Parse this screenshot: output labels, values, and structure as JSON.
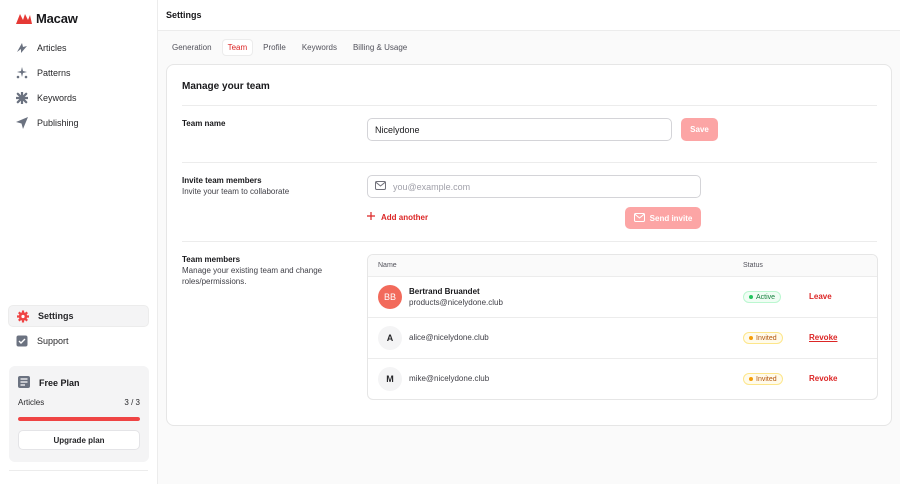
{
  "app": {
    "name": "Macaw"
  },
  "sidebar": {
    "items": [
      {
        "label": "Articles",
        "icon": "articles-icon"
      },
      {
        "label": "Patterns",
        "icon": "patterns-icon"
      },
      {
        "label": "Keywords",
        "icon": "keywords-icon"
      },
      {
        "label": "Publishing",
        "icon": "publishing-icon"
      }
    ],
    "bottom_items": [
      {
        "label": "Settings",
        "icon": "gear-icon",
        "active": true
      },
      {
        "label": "Support",
        "icon": "support-icon"
      }
    ],
    "plan": {
      "title": "Free Plan",
      "usage_label": "Articles",
      "usage_value": "3 / 3",
      "usage_fraction": 1.0,
      "upgrade_label": "Upgrade plan"
    }
  },
  "header": {
    "title": "Settings"
  },
  "tabs": [
    {
      "label": "Generation",
      "active": false
    },
    {
      "label": "Team",
      "active": true
    },
    {
      "label": "Profile",
      "active": false
    },
    {
      "label": "Keywords",
      "active": false
    },
    {
      "label": "Billing & Usage",
      "active": false
    }
  ],
  "card": {
    "title": "Manage your team",
    "team_name": {
      "label": "Team name",
      "value": "Nicelydone",
      "save_label": "Save"
    },
    "invite": {
      "label": "Invite team members",
      "description": "Invite your team to collaborate",
      "placeholder": "you@example.com",
      "add_another_label": "Add another",
      "send_label": "Send invite"
    },
    "members": {
      "label": "Team members",
      "description": "Manage your existing team and change roles/permissions.",
      "columns": {
        "name": "Name",
        "status": "Status"
      },
      "rows": [
        {
          "initials": "BB",
          "name": "Bertrand Bruandet",
          "email": "products@nicelydone.club",
          "status": "Active",
          "action": "Leave"
        },
        {
          "initials": "A",
          "name": "",
          "email": "alice@nicelydone.club",
          "status": "Invited",
          "action": "Revoke"
        },
        {
          "initials": "M",
          "name": "",
          "email": "mike@nicelydone.club",
          "status": "Invited",
          "action": "Revoke"
        }
      ]
    }
  },
  "colors": {
    "accent": "#dc2626",
    "accent_disabled": "#fca5a5",
    "avatar": "#f26a5b",
    "status_active": "#22c55e",
    "status_invited": "#f59e0b"
  }
}
